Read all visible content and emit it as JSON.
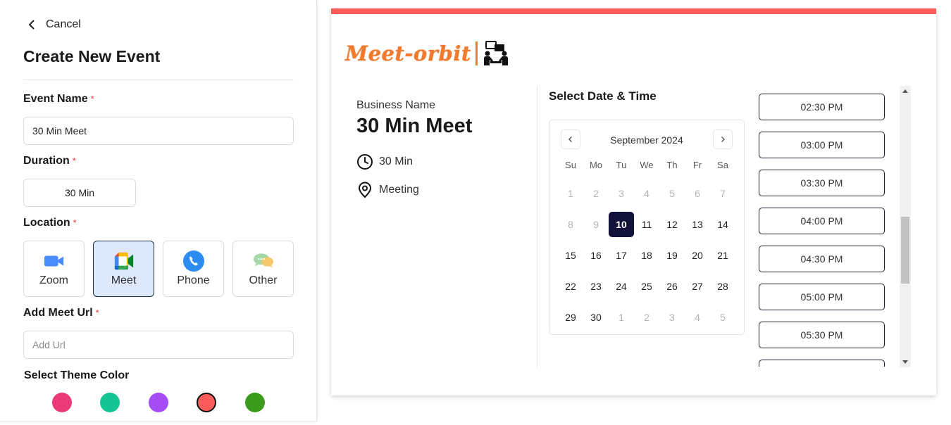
{
  "form": {
    "cancel_label": "Cancel",
    "title": "Create New Event",
    "event_name_label": "Event Name",
    "required_mark": "*",
    "event_name_value": "30 Min Meet",
    "duration_label": "Duration",
    "duration_value": "30 Min",
    "location_label": "Location",
    "locations": [
      {
        "label": "Zoom",
        "icon": "zoom-camera-icon"
      },
      {
        "label": "Meet",
        "icon": "google-meet-icon",
        "selected": true
      },
      {
        "label": "Phone",
        "icon": "phone-icon"
      },
      {
        "label": "Other",
        "icon": "chat-bubbles-icon"
      }
    ],
    "meet_url_label": "Add Meet Url",
    "meet_url_placeholder": "Add Url",
    "theme_label": "Select Theme Color",
    "theme_colors": [
      "#ec3a7a",
      "#14c493",
      "#a64cf7",
      "#fa5c5c",
      "#3c9b1c"
    ],
    "selected_theme": "#fa5c5c"
  },
  "preview": {
    "accent_color": "#fa5c5c",
    "logo_text": "Meet-orbit",
    "business_name": "Business Name",
    "event_title": "30 Min Meet",
    "duration": "30 Min",
    "location": "Meeting",
    "select_title": "Select Date & Time",
    "calendar": {
      "month": "September 2024",
      "weekdays": [
        "Su",
        "Mo",
        "Tu",
        "We",
        "Th",
        "Fr",
        "Sa"
      ],
      "weeks": [
        [
          "1",
          "2",
          "3",
          "4",
          "5",
          "6",
          "7"
        ],
        [
          "8",
          "9",
          "10",
          "11",
          "12",
          "13",
          "14"
        ],
        [
          "15",
          "16",
          "17",
          "18",
          "19",
          "20",
          "21"
        ],
        [
          "22",
          "23",
          "24",
          "25",
          "26",
          "27",
          "28"
        ],
        [
          "29",
          "30",
          "1",
          "2",
          "3",
          "4",
          "5"
        ]
      ],
      "selected_day": "10"
    },
    "time_slots": [
      "02:30 PM",
      "03:00 PM",
      "03:30 PM",
      "04:00 PM",
      "04:30 PM",
      "05:00 PM",
      "05:30 PM",
      ""
    ]
  }
}
